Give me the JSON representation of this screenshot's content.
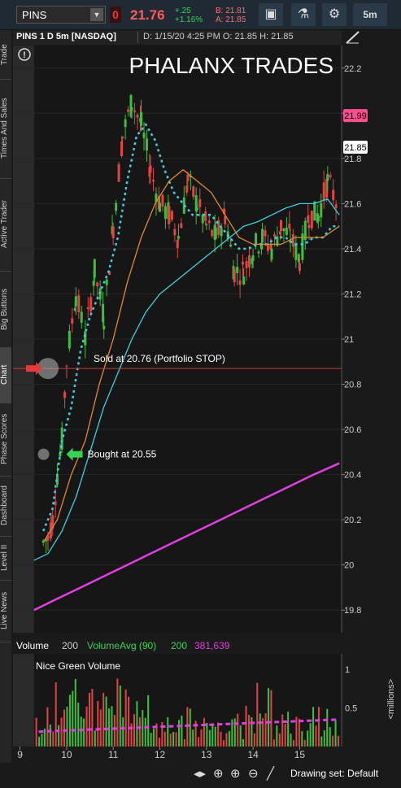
{
  "toolbar": {
    "symbol": "PINS",
    "badge": "0",
    "last": "21.76",
    "change": "+.25",
    "change_pct": "+1.16%",
    "bid": "B: 21.81",
    "ask": "A: 21.85",
    "timeframe": "5m"
  },
  "sidebar": {
    "tabs": [
      "Live News",
      "Level II",
      "Dashboard",
      "Phase Scores",
      "Chart",
      "Big Buttons",
      "Active Trader",
      "Times And Sales",
      "Trade"
    ]
  },
  "header": {
    "symbol": "PINS 1 D 5m [NASDAQ]",
    "info": "D: 1/15/20 4:25 PM   O: 21.85   H: 21.85"
  },
  "chart_data": {
    "type": "candlestick",
    "title": "PHALANX TRADES",
    "ylim": [
      19.7,
      22.3
    ],
    "y_ticks": [
      19.8,
      20,
      20.2,
      20.4,
      20.6,
      20.8,
      21,
      21.2,
      21.4,
      21.6,
      21.8,
      22,
      22.2
    ],
    "x_ticks": [
      "9",
      "10",
      "11",
      "12",
      "13",
      "14",
      "15"
    ],
    "price_labels": [
      {
        "value": 21.99,
        "text": "21.99",
        "color": "#ff4d8d"
      },
      {
        "value": 21.85,
        "text": "21.85",
        "color": "#ffffff"
      }
    ],
    "hline": {
      "value": 20.87,
      "color": "#cc3b3b"
    },
    "annotations": [
      {
        "text": "Sold at 20.76 (Portfolio STOP)",
        "x": 9.95,
        "y": 20.87,
        "marker": "red-arrow"
      },
      {
        "text": "Bought at 20.55",
        "x": 9.75,
        "y": 20.49,
        "marker": "green-arrow"
      }
    ],
    "series": [
      {
        "name": "Price close",
        "x": [
          9.5,
          9.6,
          9.7,
          9.8,
          9.9,
          10.0,
          10.2,
          10.4,
          10.6,
          10.8,
          11.0,
          11.2,
          11.4,
          11.6,
          11.8,
          12.0,
          12.2,
          12.4,
          12.6,
          12.8,
          13.0,
          13.2,
          13.4,
          13.6,
          13.8,
          14.0,
          14.2,
          14.4,
          14.6,
          14.8,
          15.0,
          15.2,
          15.4,
          15.6,
          15.8
        ],
        "values": [
          20.1,
          20.12,
          20.2,
          20.4,
          20.55,
          20.9,
          21.2,
          21.0,
          21.3,
          21.1,
          21.5,
          21.9,
          22.05,
          21.95,
          21.75,
          21.6,
          21.55,
          21.45,
          21.7,
          21.6,
          21.5,
          21.45,
          21.55,
          21.3,
          21.3,
          21.4,
          21.45,
          21.4,
          21.5,
          21.45,
          21.35,
          21.55,
          21.55,
          21.7,
          21.6
        ]
      },
      {
        "name": "MA fast dotted cyan",
        "x": [
          9.5,
          9.7,
          9.9,
          10.1,
          10.3,
          10.5,
          10.7,
          10.9,
          11.1,
          11.3,
          11.5,
          11.7,
          11.9,
          12.1,
          12.3,
          12.5,
          12.7,
          12.9,
          13.1,
          13.3,
          13.5,
          13.7,
          13.9,
          14.1,
          14.3,
          14.5,
          14.7,
          14.9,
          15.1,
          15.3,
          15.5,
          15.7,
          15.85
        ],
        "values": [
          20.15,
          20.25,
          20.55,
          20.7,
          20.95,
          21.1,
          21.2,
          21.3,
          21.45,
          21.7,
          21.9,
          21.95,
          21.88,
          21.75,
          21.65,
          21.6,
          21.55,
          21.55,
          21.55,
          21.5,
          21.45,
          21.4,
          21.4,
          21.42,
          21.42,
          21.45,
          21.45,
          21.42,
          21.42,
          21.45,
          21.45,
          21.5,
          21.5
        ]
      },
      {
        "name": "MA mid orange",
        "x": [
          9.5,
          9.8,
          10.1,
          10.4,
          10.7,
          11.0,
          11.3,
          11.6,
          11.9,
          12.2,
          12.5,
          12.8,
          13.1,
          13.4,
          13.7,
          14.0,
          14.3,
          14.6,
          14.9,
          15.2,
          15.5,
          15.85
        ],
        "values": [
          20.1,
          20.2,
          20.4,
          20.55,
          20.8,
          21.0,
          21.25,
          21.45,
          21.6,
          21.7,
          21.75,
          21.7,
          21.65,
          21.55,
          21.45,
          21.42,
          21.42,
          21.42,
          21.45,
          21.45,
          21.45,
          21.5
        ]
      },
      {
        "name": "MA slow cyan",
        "x": [
          9.3,
          9.6,
          9.9,
          10.2,
          10.5,
          10.8,
          11.1,
          11.4,
          11.7,
          12.0,
          12.3,
          12.6,
          12.9,
          13.2,
          13.5,
          13.8,
          14.1,
          14.4,
          14.7,
          15.0,
          15.3,
          15.6,
          15.85
        ],
        "values": [
          20.02,
          20.05,
          20.15,
          20.3,
          20.5,
          20.7,
          20.85,
          21.0,
          21.12,
          21.2,
          21.25,
          21.3,
          21.35,
          21.4,
          21.45,
          21.5,
          21.52,
          21.55,
          21.58,
          21.6,
          21.6,
          21.62,
          21.55
        ]
      },
      {
        "name": "VWAP magenta",
        "x": [
          9.3,
          9.8,
          10.3,
          10.8,
          11.3,
          11.8,
          12.3,
          12.8,
          13.3,
          13.8,
          14.3,
          14.8,
          15.3,
          15.85
        ],
        "values": [
          19.8,
          19.85,
          19.9,
          19.95,
          20.0,
          20.05,
          20.1,
          20.15,
          20.2,
          20.25,
          20.3,
          20.35,
          20.4,
          20.45
        ]
      }
    ],
    "volume": {
      "study": "Volume",
      "period": "200",
      "avg_label": "VolumeAvg (90)",
      "avg_period": "200",
      "value": "381,639",
      "note": "Nice Green Volume",
      "axis_label": "<millions>",
      "ylim": [
        0,
        1.2
      ],
      "y_ticks": [
        "0.5",
        "1"
      ],
      "avg": 0.35
    }
  },
  "bottombar": {
    "drawing_set": "Drawing set: Default"
  },
  "colors": {
    "up": "#3fbf3f",
    "down": "#e04545",
    "cyan": "#3fd0e0",
    "orange": "#e08a2a",
    "magenta": "#e040e0",
    "accent": "#ff4d8d"
  }
}
